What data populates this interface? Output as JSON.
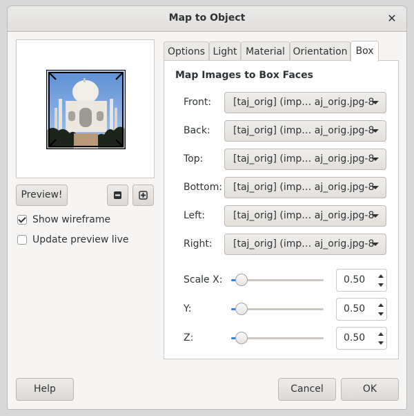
{
  "window": {
    "title": "Map to Object"
  },
  "left": {
    "preview_button": "Preview!",
    "zoom_out_icon": "zoom-out-icon",
    "zoom_in_icon": "zoom-in-icon",
    "show_wireframe": {
      "label": "Show wireframe",
      "checked": true
    },
    "update_preview_live": {
      "label": "Update preview live",
      "checked": false
    }
  },
  "tabs": [
    {
      "label": "Options"
    },
    {
      "label": "Light"
    },
    {
      "label": "Material"
    },
    {
      "label": "Orientation"
    },
    {
      "label": "Box",
      "active": true
    }
  ],
  "box": {
    "section_title": "Map Images to Box Faces",
    "faces": [
      {
        "label": "Front:",
        "value": "[taj_orig] (imp… aj_orig.jpg-8"
      },
      {
        "label": "Back:",
        "value": "[taj_orig] (imp… aj_orig.jpg-8"
      },
      {
        "label": "Top:",
        "value": "[taj_orig] (imp… aj_orig.jpg-8"
      },
      {
        "label": "Bottom:",
        "value": "[taj_orig] (imp… aj_orig.jpg-8"
      },
      {
        "label": "Left:",
        "value": "[taj_orig] (imp… aj_orig.jpg-8"
      },
      {
        "label": "Right:",
        "value": "[taj_orig] (imp… aj_orig.jpg-8"
      }
    ],
    "scales": [
      {
        "label": "Scale X:",
        "value": "0.50",
        "fraction": 0.05
      },
      {
        "label": "Y:",
        "value": "0.50",
        "fraction": 0.05
      },
      {
        "label": "Z:",
        "value": "0.50",
        "fraction": 0.05
      }
    ]
  },
  "buttons": {
    "help": "Help",
    "cancel": "Cancel",
    "ok": "OK"
  },
  "colors": {
    "accent": "#3584e4"
  }
}
